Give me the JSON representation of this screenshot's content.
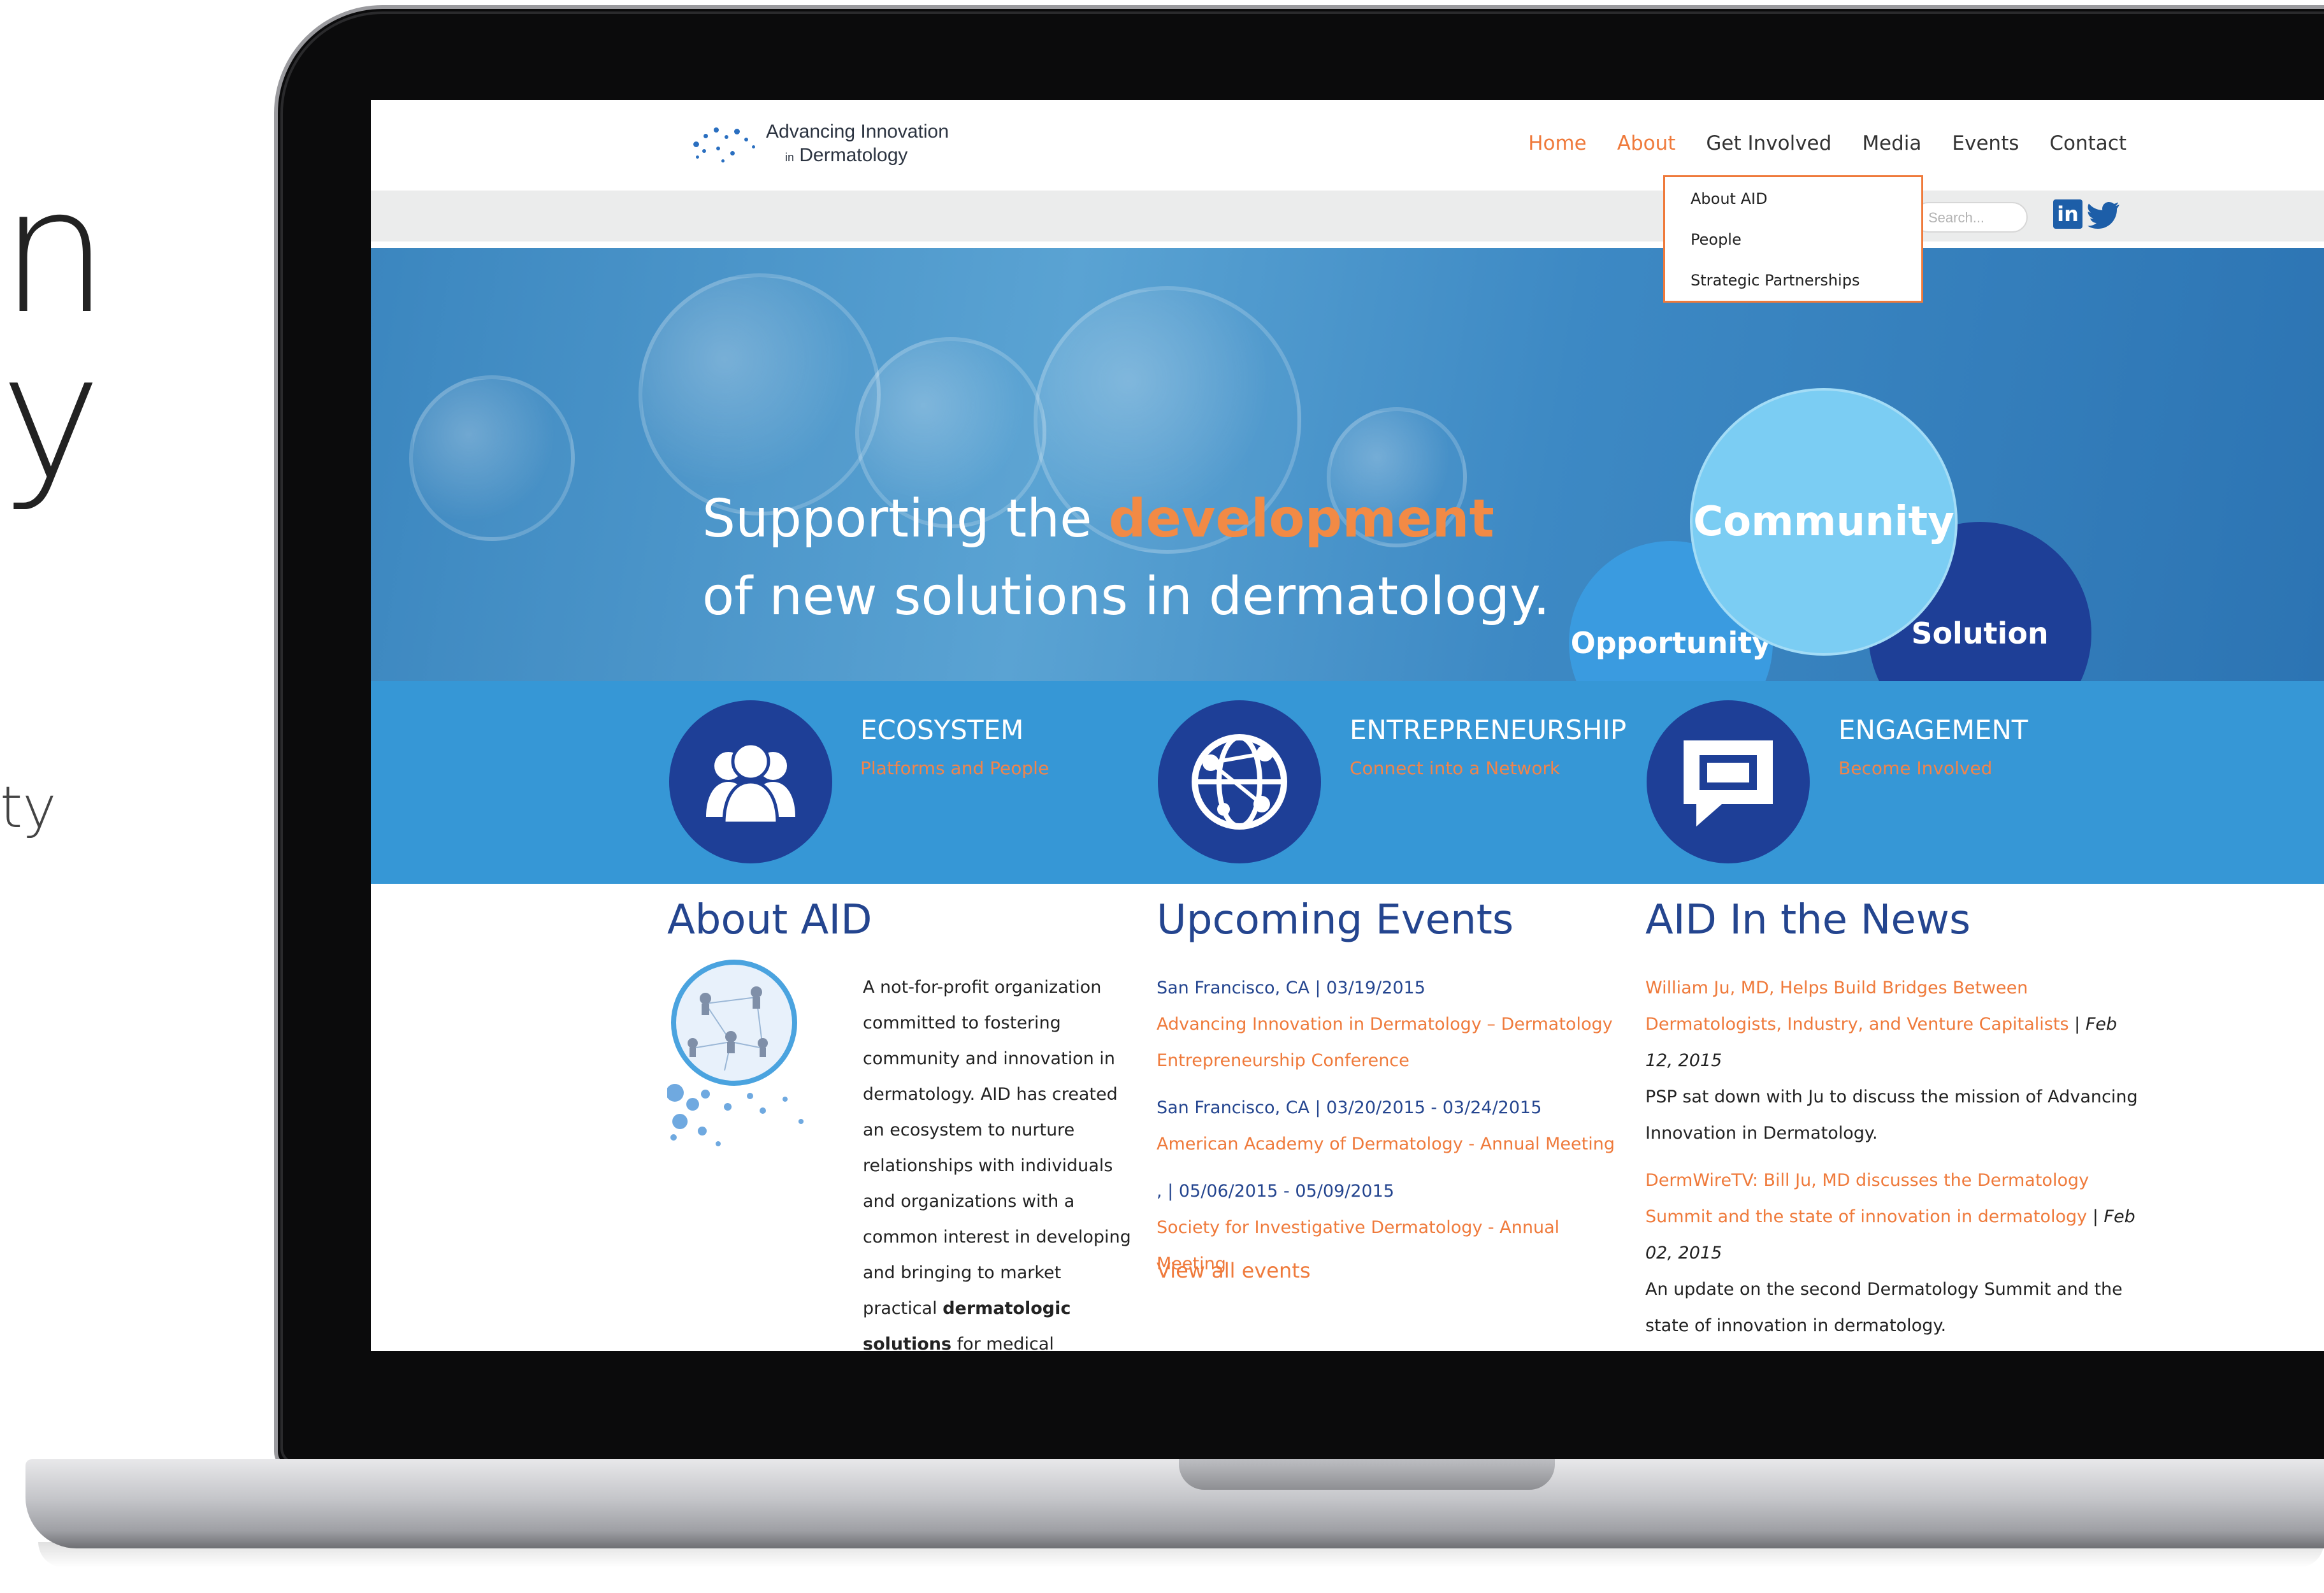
{
  "side": {
    "big1": "n",
    "big2": "y",
    "small": "ty"
  },
  "site": {
    "logo_line1": "Advancing Innovation",
    "logo_line2_prefix": "in",
    "logo_line2": "Dermatology"
  },
  "nav": {
    "items": [
      "Home",
      "About",
      "Get Involved",
      "Media",
      "Events",
      "Contact"
    ],
    "active": "Home",
    "hover": "About"
  },
  "dropdown": {
    "items": [
      "About AID",
      "People",
      "Strategic Partnerships"
    ]
  },
  "search": {
    "placeholder": "Search..."
  },
  "social": {
    "linkedin": "in"
  },
  "hero": {
    "line1_prefix": "Supporting the",
    "line1_highlight": "development",
    "line2": "of new solutions in dermatology.",
    "circles": [
      "Community",
      "Opportunity",
      "Solution"
    ]
  },
  "features": [
    {
      "title": "ECOSYSTEM",
      "subtitle": "Platforms and People",
      "icon": "people-icon"
    },
    {
      "title": "ENTREPRENEURSHIP",
      "subtitle": "Connect into a Network",
      "icon": "globe-network-icon"
    },
    {
      "title": "ENGAGEMENT",
      "subtitle": "Become Involved",
      "icon": "chat-bubble-icon"
    }
  ],
  "about": {
    "title": "About AID",
    "text_plain1": "A not-for-profit organization committed to fostering community and innovation in dermatology. AID has created an ecosystem to nurture relationships with individuals and organizations with a common interest in developing and bringing to market practical",
    "text_bold": "dermatologic solutions",
    "text_plain2": "for medical"
  },
  "events": {
    "title": "Upcoming Events",
    "items": [
      {
        "meta": "San Francisco, CA | 03/19/2015",
        "title": "Advancing Innovation in Dermatology – Dermatology Entrepreneurship Conference"
      },
      {
        "meta": "San Francisco, CA | 03/20/2015 - 03/24/2015",
        "title": "American Academy of Dermatology - Annual Meeting"
      },
      {
        "meta": ", | 05/06/2015 - 05/09/2015",
        "title": "Society for Investigative Dermatology - Annual Meeting"
      }
    ],
    "view_all": "View all events"
  },
  "news": {
    "title": "AID In the News",
    "items": [
      {
        "link": "William Ju, MD, Helps Build Bridges Between Dermatologists, Industry, and Venture Capitalists",
        "sep": "|",
        "date": "Feb 12, 2015",
        "desc": "PSP sat down with Ju to discuss the mission of Advancing Innovation in Dermatology."
      },
      {
        "link": "DermWireTV: Bill Ju, MD discusses the Dermatology Summit and the state of innovation in dermatology",
        "sep": "|",
        "date": "Feb 02, 2015",
        "desc": "An update on the second Dermatology Summit and the state of innovation in dermatology."
      }
    ]
  },
  "colors": {
    "accent_orange": "#ef7a3b",
    "navy": "#1e3f97",
    "band_blue": "#3697d6",
    "heading_blue": "#24458f"
  }
}
